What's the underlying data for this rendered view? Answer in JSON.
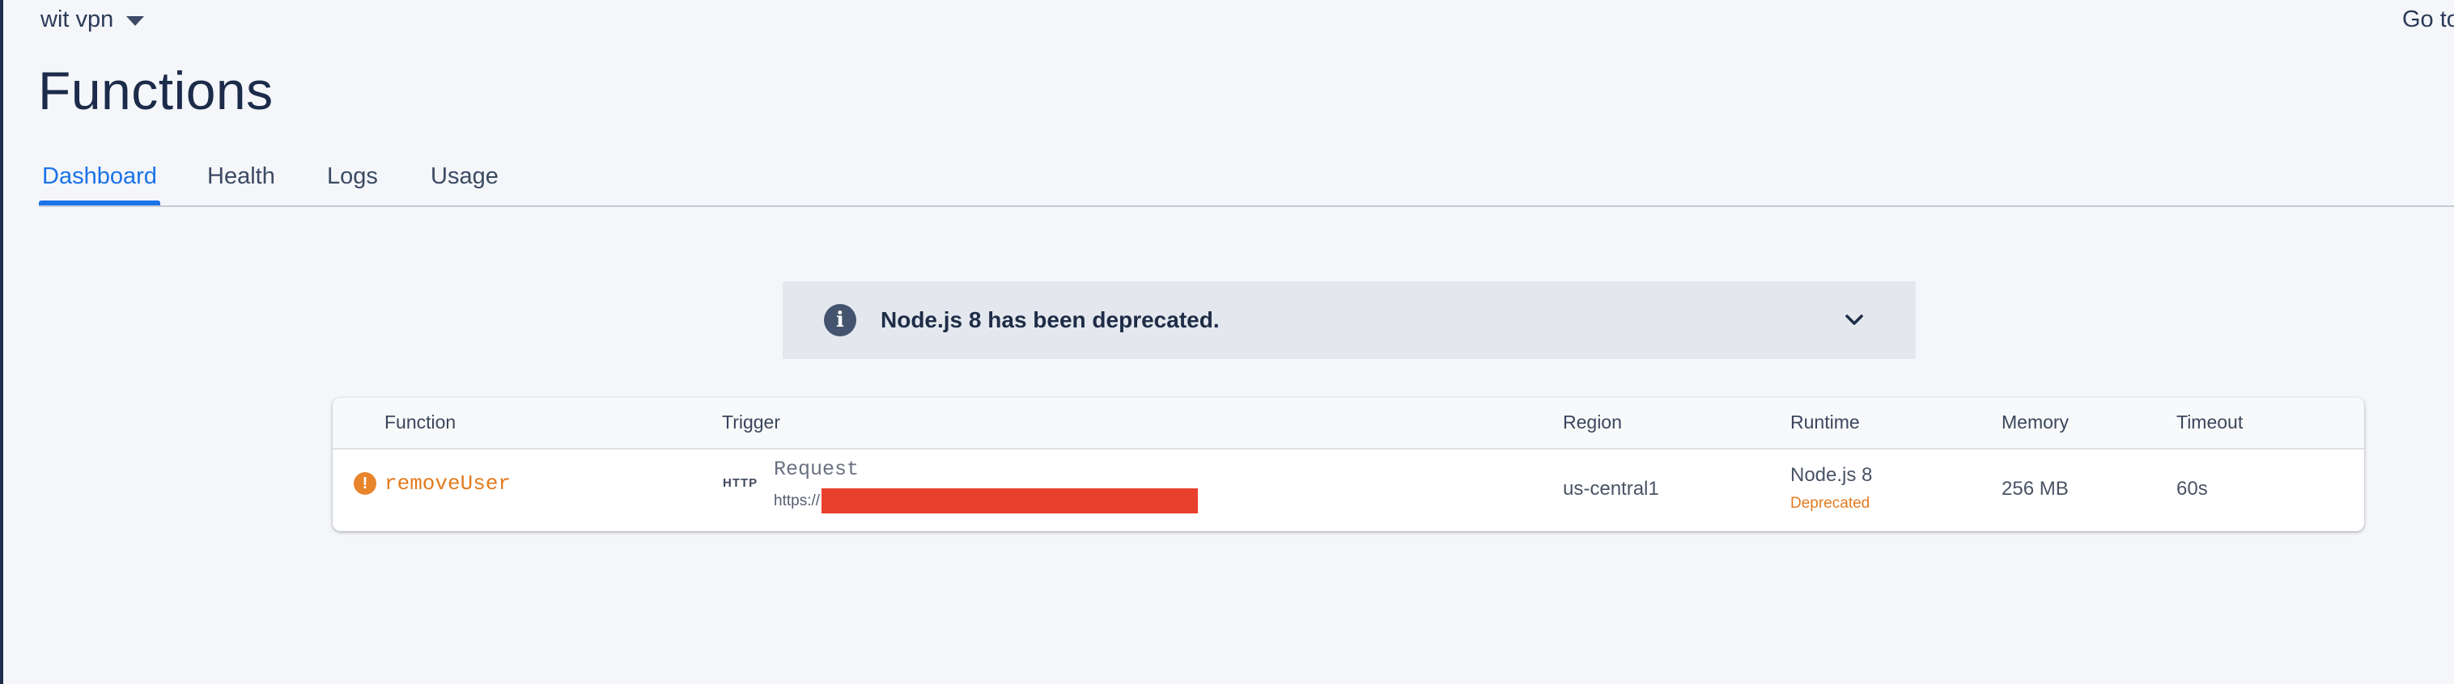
{
  "header": {
    "project_name": "wit vpn",
    "goto_label": "Go to"
  },
  "page": {
    "title": "Functions"
  },
  "tabs": [
    {
      "label": "Dashboard",
      "active": true
    },
    {
      "label": "Health",
      "active": false
    },
    {
      "label": "Logs",
      "active": false
    },
    {
      "label": "Usage",
      "active": false
    }
  ],
  "banner": {
    "icon": "info-icon",
    "message": "Node.js 8 has been deprecated.",
    "toggle_icon": "chevron-down-icon"
  },
  "table": {
    "columns": [
      "Function",
      "Trigger",
      "Region",
      "Runtime",
      "Memory",
      "Timeout"
    ],
    "rows": [
      {
        "status_icon": "warning-icon",
        "function": "removeUser",
        "trigger_badge": "HTTP",
        "trigger_type": "Request",
        "trigger_url_prefix": "https://",
        "region": "us-central1",
        "runtime": "Node.js 8",
        "runtime_status": "Deprecated",
        "memory": "256 MB",
        "timeout": "60s"
      }
    ]
  },
  "colors": {
    "accent": "#1a73e8",
    "warning": "#e37b20",
    "redaction": "#e8402d",
    "background": "#f4f6f9"
  }
}
